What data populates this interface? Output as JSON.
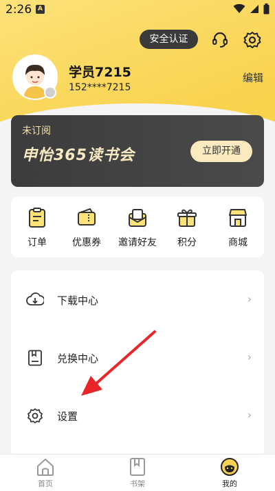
{
  "status_bar": {
    "time": "2:26",
    "notif": "A"
  },
  "header": {
    "security_label": "安全认证"
  },
  "user": {
    "name": "学员7215",
    "phone": "152****7215",
    "edit_label": "编辑"
  },
  "member_card": {
    "status": "未订阅",
    "title": "申怡365读书会",
    "button_label": "立即开通"
  },
  "quick_items": [
    {
      "label": "订单",
      "icon": "order-icon"
    },
    {
      "label": "优惠券",
      "icon": "coupon-icon"
    },
    {
      "label": "邀请好友",
      "icon": "invite-icon"
    },
    {
      "label": "积分",
      "icon": "gift-icon"
    },
    {
      "label": "商城",
      "icon": "store-icon"
    }
  ],
  "menu_items": [
    {
      "label": "下载中心",
      "icon": "download-icon"
    },
    {
      "label": "兑换中心",
      "icon": "redeem-icon"
    },
    {
      "label": "设置",
      "icon": "settings-icon"
    }
  ],
  "bottom_nav": [
    {
      "label": "首页",
      "icon": "home-icon"
    },
    {
      "label": "书架",
      "icon": "bookshelf-icon"
    },
    {
      "label": "我的",
      "icon": "profile-icon",
      "active": true
    }
  ],
  "colors": {
    "accent": "#f9d34f",
    "card_dark": "#3c3c3c",
    "annotation": "#e8262a"
  }
}
